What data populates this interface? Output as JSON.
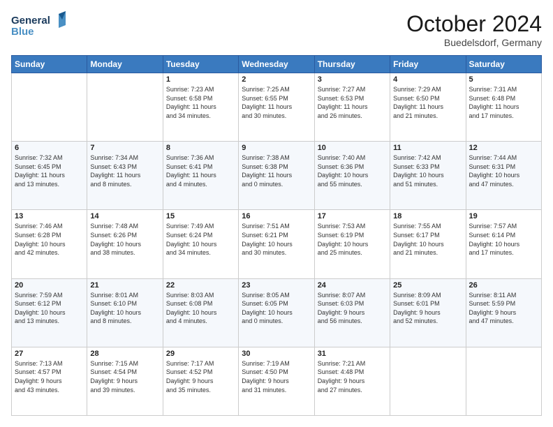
{
  "logo": {
    "line1": "General",
    "line2": "Blue"
  },
  "title": "October 2024",
  "location": "Buedelsdorf, Germany",
  "days_header": [
    "Sunday",
    "Monday",
    "Tuesday",
    "Wednesday",
    "Thursday",
    "Friday",
    "Saturday"
  ],
  "weeks": [
    [
      {
        "day": "",
        "info": ""
      },
      {
        "day": "",
        "info": ""
      },
      {
        "day": "1",
        "info": "Sunrise: 7:23 AM\nSunset: 6:58 PM\nDaylight: 11 hours\nand 34 minutes."
      },
      {
        "day": "2",
        "info": "Sunrise: 7:25 AM\nSunset: 6:55 PM\nDaylight: 11 hours\nand 30 minutes."
      },
      {
        "day": "3",
        "info": "Sunrise: 7:27 AM\nSunset: 6:53 PM\nDaylight: 11 hours\nand 26 minutes."
      },
      {
        "day": "4",
        "info": "Sunrise: 7:29 AM\nSunset: 6:50 PM\nDaylight: 11 hours\nand 21 minutes."
      },
      {
        "day": "5",
        "info": "Sunrise: 7:31 AM\nSunset: 6:48 PM\nDaylight: 11 hours\nand 17 minutes."
      }
    ],
    [
      {
        "day": "6",
        "info": "Sunrise: 7:32 AM\nSunset: 6:45 PM\nDaylight: 11 hours\nand 13 minutes."
      },
      {
        "day": "7",
        "info": "Sunrise: 7:34 AM\nSunset: 6:43 PM\nDaylight: 11 hours\nand 8 minutes."
      },
      {
        "day": "8",
        "info": "Sunrise: 7:36 AM\nSunset: 6:41 PM\nDaylight: 11 hours\nand 4 minutes."
      },
      {
        "day": "9",
        "info": "Sunrise: 7:38 AM\nSunset: 6:38 PM\nDaylight: 11 hours\nand 0 minutes."
      },
      {
        "day": "10",
        "info": "Sunrise: 7:40 AM\nSunset: 6:36 PM\nDaylight: 10 hours\nand 55 minutes."
      },
      {
        "day": "11",
        "info": "Sunrise: 7:42 AM\nSunset: 6:33 PM\nDaylight: 10 hours\nand 51 minutes."
      },
      {
        "day": "12",
        "info": "Sunrise: 7:44 AM\nSunset: 6:31 PM\nDaylight: 10 hours\nand 47 minutes."
      }
    ],
    [
      {
        "day": "13",
        "info": "Sunrise: 7:46 AM\nSunset: 6:28 PM\nDaylight: 10 hours\nand 42 minutes."
      },
      {
        "day": "14",
        "info": "Sunrise: 7:48 AM\nSunset: 6:26 PM\nDaylight: 10 hours\nand 38 minutes."
      },
      {
        "day": "15",
        "info": "Sunrise: 7:49 AM\nSunset: 6:24 PM\nDaylight: 10 hours\nand 34 minutes."
      },
      {
        "day": "16",
        "info": "Sunrise: 7:51 AM\nSunset: 6:21 PM\nDaylight: 10 hours\nand 30 minutes."
      },
      {
        "day": "17",
        "info": "Sunrise: 7:53 AM\nSunset: 6:19 PM\nDaylight: 10 hours\nand 25 minutes."
      },
      {
        "day": "18",
        "info": "Sunrise: 7:55 AM\nSunset: 6:17 PM\nDaylight: 10 hours\nand 21 minutes."
      },
      {
        "day": "19",
        "info": "Sunrise: 7:57 AM\nSunset: 6:14 PM\nDaylight: 10 hours\nand 17 minutes."
      }
    ],
    [
      {
        "day": "20",
        "info": "Sunrise: 7:59 AM\nSunset: 6:12 PM\nDaylight: 10 hours\nand 13 minutes."
      },
      {
        "day": "21",
        "info": "Sunrise: 8:01 AM\nSunset: 6:10 PM\nDaylight: 10 hours\nand 8 minutes."
      },
      {
        "day": "22",
        "info": "Sunrise: 8:03 AM\nSunset: 6:08 PM\nDaylight: 10 hours\nand 4 minutes."
      },
      {
        "day": "23",
        "info": "Sunrise: 8:05 AM\nSunset: 6:05 PM\nDaylight: 10 hours\nand 0 minutes."
      },
      {
        "day": "24",
        "info": "Sunrise: 8:07 AM\nSunset: 6:03 PM\nDaylight: 9 hours\nand 56 minutes."
      },
      {
        "day": "25",
        "info": "Sunrise: 8:09 AM\nSunset: 6:01 PM\nDaylight: 9 hours\nand 52 minutes."
      },
      {
        "day": "26",
        "info": "Sunrise: 8:11 AM\nSunset: 5:59 PM\nDaylight: 9 hours\nand 47 minutes."
      }
    ],
    [
      {
        "day": "27",
        "info": "Sunrise: 7:13 AM\nSunset: 4:57 PM\nDaylight: 9 hours\nand 43 minutes."
      },
      {
        "day": "28",
        "info": "Sunrise: 7:15 AM\nSunset: 4:54 PM\nDaylight: 9 hours\nand 39 minutes."
      },
      {
        "day": "29",
        "info": "Sunrise: 7:17 AM\nSunset: 4:52 PM\nDaylight: 9 hours\nand 35 minutes."
      },
      {
        "day": "30",
        "info": "Sunrise: 7:19 AM\nSunset: 4:50 PM\nDaylight: 9 hours\nand 31 minutes."
      },
      {
        "day": "31",
        "info": "Sunrise: 7:21 AM\nSunset: 4:48 PM\nDaylight: 9 hours\nand 27 minutes."
      },
      {
        "day": "",
        "info": ""
      },
      {
        "day": "",
        "info": ""
      }
    ]
  ]
}
